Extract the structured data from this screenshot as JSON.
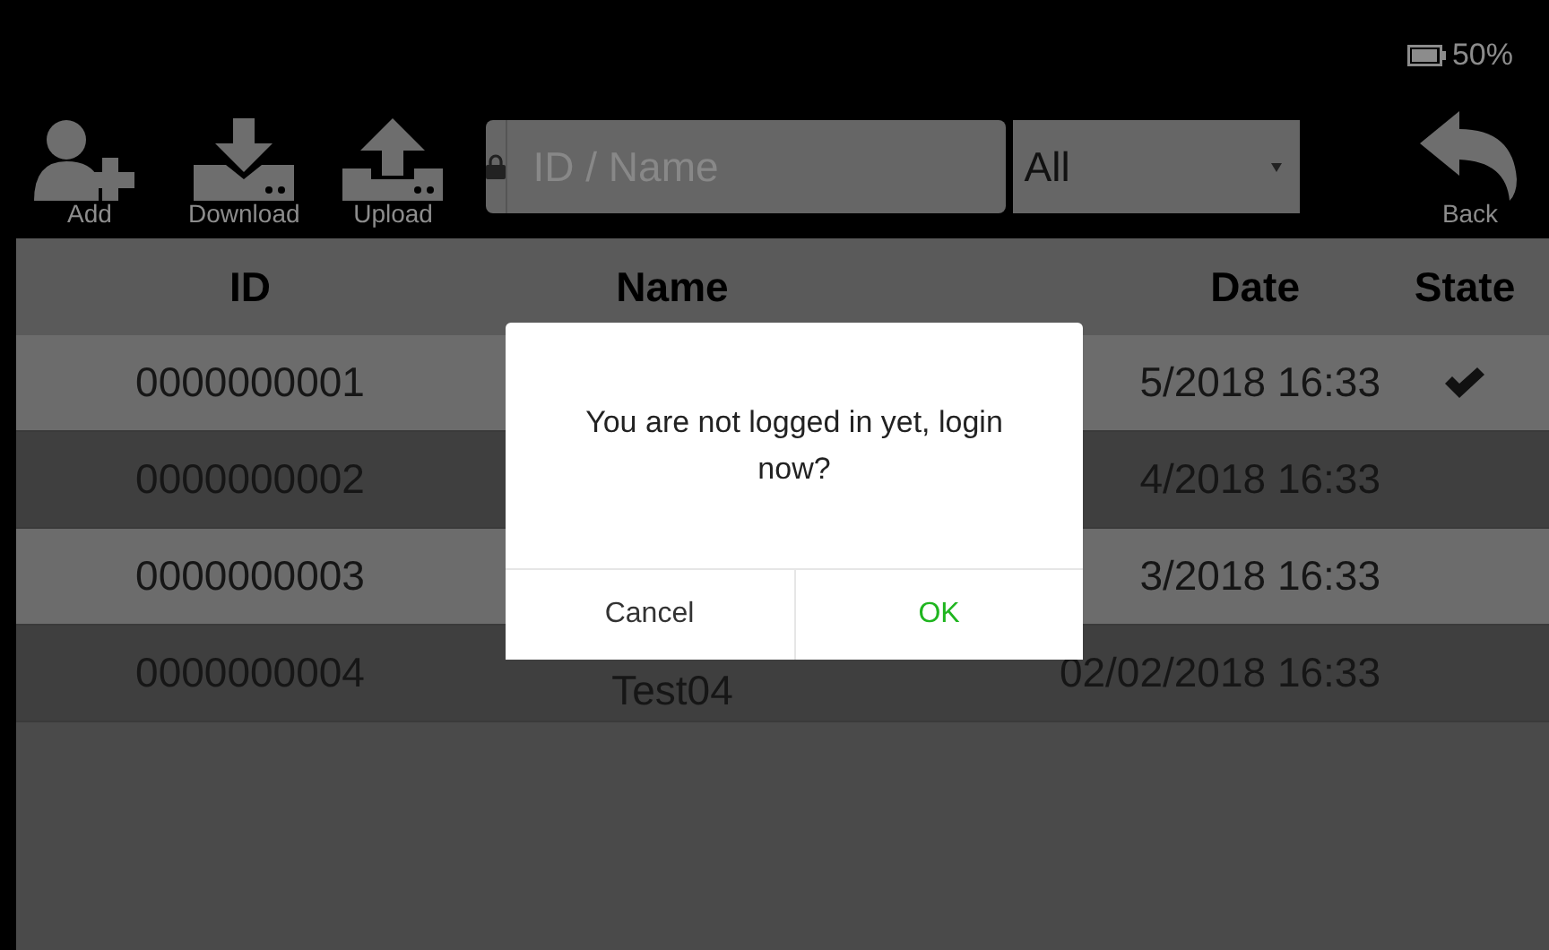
{
  "status": {
    "battery": "50%"
  },
  "toolbar": {
    "buttons": [
      {
        "kind": "add",
        "label": "Add"
      },
      {
        "kind": "download",
        "label": "Download"
      },
      {
        "kind": "upload",
        "label": "Upload"
      }
    ],
    "search": {
      "placeholder": "ID / Name"
    },
    "filter": {
      "value": "All"
    },
    "back": {
      "label": "Back"
    }
  },
  "table": {
    "columns": [
      "ID",
      "Name",
      "Date",
      "State"
    ],
    "rows": [
      {
        "id": "0000000001",
        "date": "5/2018 16:33",
        "checked": true
      },
      {
        "id": "0000000002",
        "date": "4/2018 16:33",
        "checked": false
      },
      {
        "id": "0000000003",
        "date": "3/2018 16:33",
        "checked": false
      },
      {
        "id": "0000000004",
        "name": "Test04",
        "date": "02/02/2018 16:33",
        "checked": false
      }
    ]
  },
  "dialog": {
    "message": "You are not logged in yet, login now?",
    "buttons": [
      {
        "kind": "cancel",
        "label": "Cancel"
      },
      {
        "kind": "ok",
        "label": "OK"
      }
    ]
  }
}
